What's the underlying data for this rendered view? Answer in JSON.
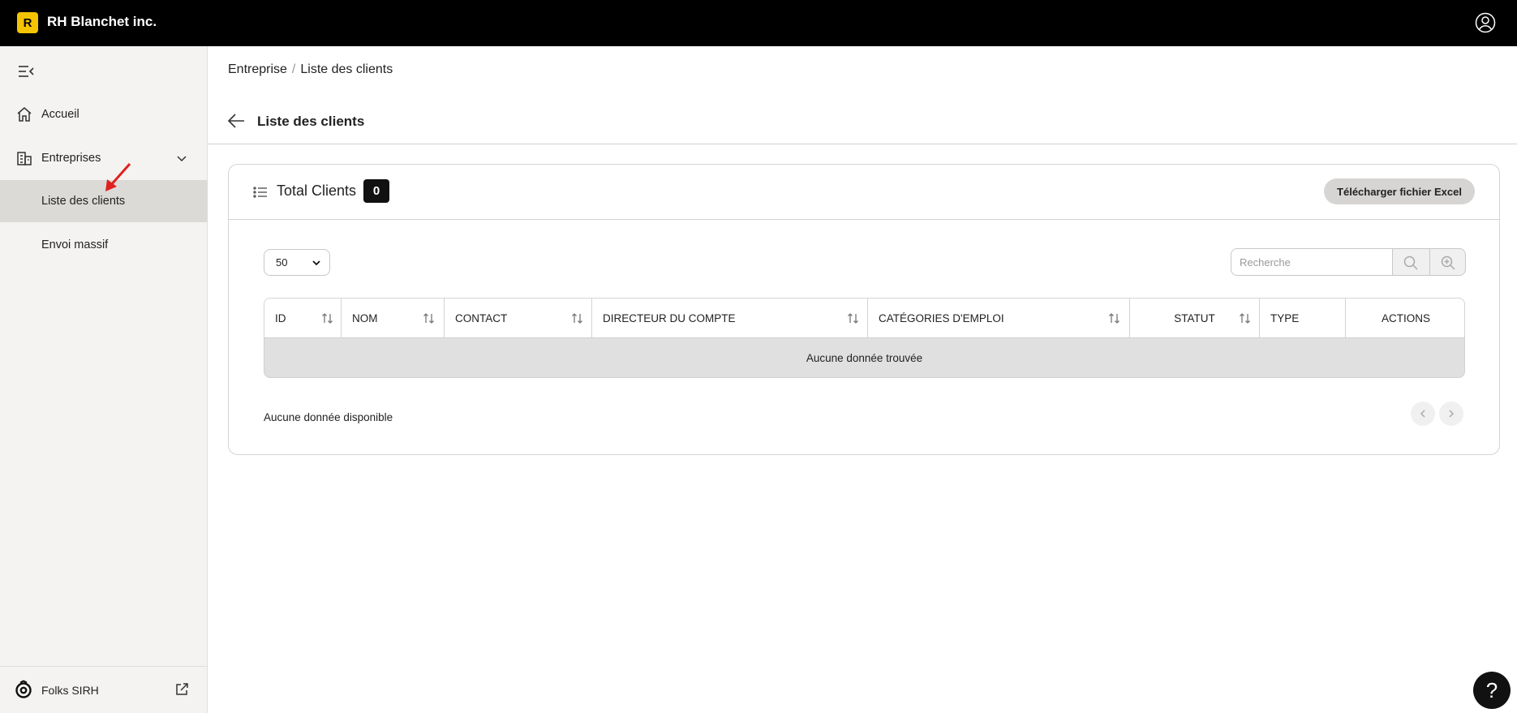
{
  "topbar": {
    "logo_letter": "R",
    "company": "RH Blanchet inc."
  },
  "sidebar": {
    "items": [
      {
        "label": "Accueil"
      },
      {
        "label": "Entreprises"
      },
      {
        "label": "Liste des clients"
      },
      {
        "label": "Envoi massif"
      }
    ],
    "footer_label": "Folks SIRH"
  },
  "breadcrumb": {
    "parent": "Entreprise",
    "sep": "/",
    "current": "Liste des clients"
  },
  "page": {
    "title": "Liste des clients"
  },
  "card": {
    "total_label": "Total Clients",
    "total_count": "0",
    "excel_button": "Télécharger fichier Excel"
  },
  "controls": {
    "page_size": "50",
    "search_placeholder": "Recherche"
  },
  "table": {
    "columns": [
      "ID",
      "NOM",
      "CONTACT",
      "DIRECTEUR DU COMPTE",
      "CATÉGORIES D'EMPLOI",
      "STATUT",
      "TYPE",
      "ACTIONS"
    ],
    "empty_message": "Aucune donnée trouvée"
  },
  "footer": {
    "info": "Aucune donnée disponible"
  },
  "help": {
    "label": "?"
  },
  "colors": {
    "brand": "#f5c400",
    "topbar": "#000000",
    "active_item": "#dcdad7",
    "annotation_arrow": "#e02020"
  }
}
